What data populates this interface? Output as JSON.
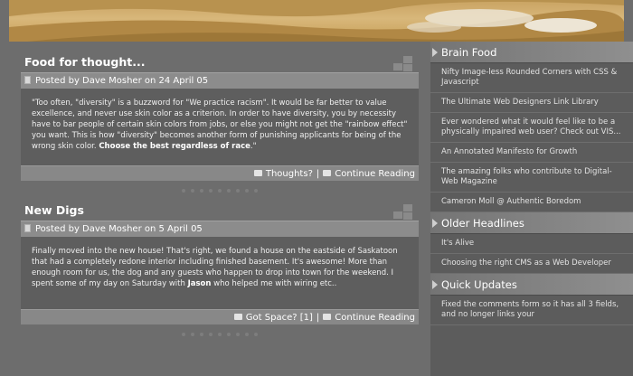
{
  "posts": [
    {
      "title": "Food for thought...",
      "meta": "Posted by Dave Mosher on 24 April 05",
      "body": "\"Too often, \"diversity\" is a buzzword for \"We practice racism\". It would be far better to value excellence, and never use skin color as a criterion. In order to have diversity, you by necessity have to bar people of certain skin colors from jobs, or else you might not get the \"rainbow effect\" you want. This is how \"diversity\" becomes another form of punishing applicants for being of the wrong skin color. ",
      "body_bold": "Choose the best regardless of race",
      "body_end": ".\"",
      "comments": "Thoughts?",
      "separator": "|",
      "more": "Continue Reading"
    },
    {
      "title": "New Digs",
      "meta": "Posted by Dave Mosher on 5 April 05",
      "body": "Finally moved into the new house! That's right, we found a house on the eastside of Saskatoon that had a completely redone interior including finished basement. It's awesome! More than enough room for us, the dog and any guests who happen to drop into town for the weekend. I spent some of my day on Saturday with ",
      "body_bold": "Jason",
      "body_end": " who helped me with wiring etc..",
      "comments": "Got Space? [1]",
      "separator": "|",
      "more": "Continue Reading"
    }
  ],
  "sidebar": {
    "brain_food": {
      "title": "Brain Food",
      "items": [
        "Nifty Image-less Rounded Corners with CSS & Javascript",
        "The Ultimate Web Designers Link Library",
        "Ever wondered what it would feel like to be a physically impaired web user? Check out VIS...",
        "An Annotated Manifesto for Growth",
        "The amazing folks who contribute to Digital-Web Magazine",
        "Cameron Moll @ Authentic Boredom"
      ]
    },
    "older": {
      "title": "Older Headlines",
      "items": [
        "It's Alive",
        "Choosing the right CMS as a Web Developer"
      ]
    },
    "quick": {
      "title": "Quick Updates",
      "items": [
        "Fixed the comments form so it has all 3 fields, and no longer links your"
      ]
    }
  },
  "colors": {
    "background": "#6d6d6d",
    "sand": "#c9a362"
  }
}
